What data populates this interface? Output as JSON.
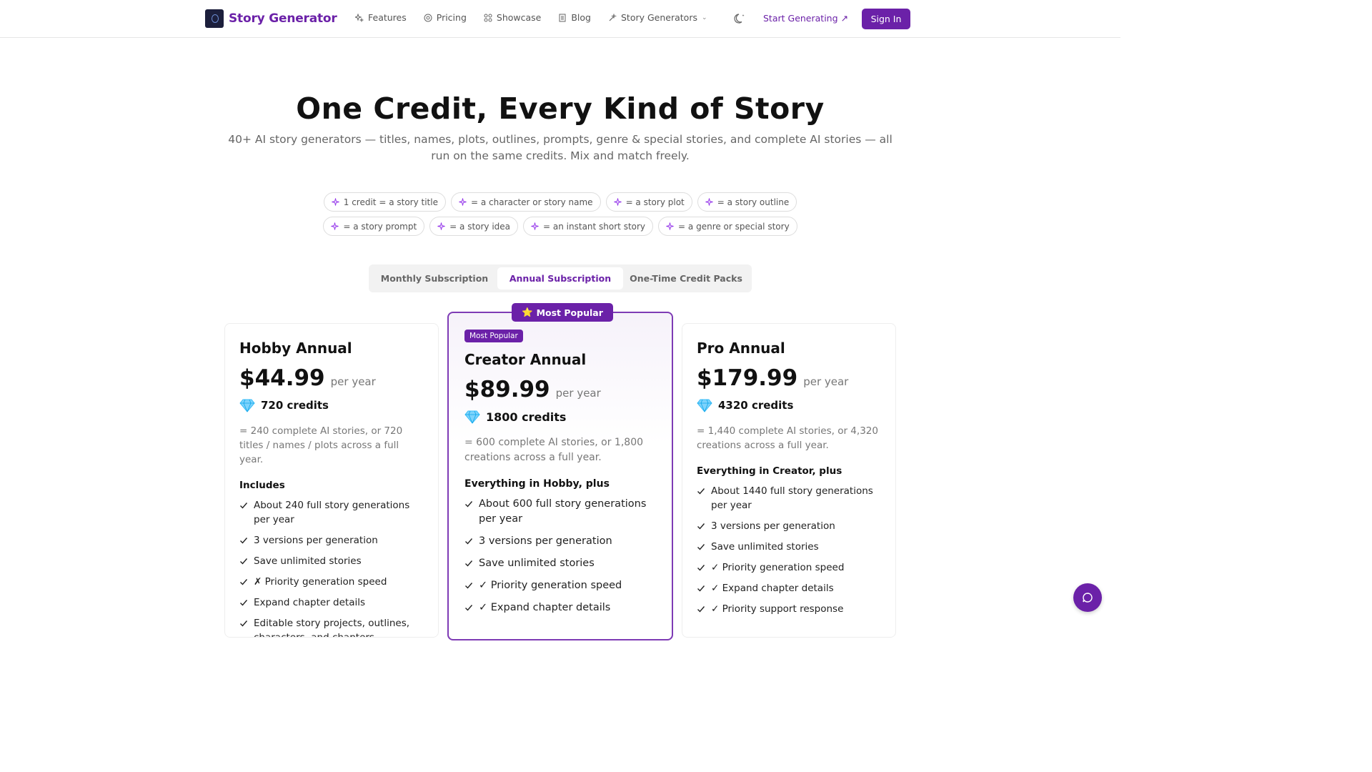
{
  "header": {
    "brand": "Story Generator",
    "nav": [
      {
        "label": "Features",
        "icon": "sparkles-icon"
      },
      {
        "label": "Pricing",
        "icon": "coin-icon"
      },
      {
        "label": "Showcase",
        "icon": "grid-icon"
      },
      {
        "label": "Blog",
        "icon": "document-icon"
      },
      {
        "label": "Story Generators",
        "icon": "magic-wand-icon"
      }
    ],
    "start_label": "Start Generating",
    "signin_label": "Sign In"
  },
  "hero": {
    "title": "One Credit, Every Kind of Story",
    "subtitle": "40+ AI story generators — titles, names, plots, outlines, prompts, genre & special stories, and complete AI stories — all run on the same credits. Mix and match freely."
  },
  "chips": {
    "row1": [
      "1 credit = a story title",
      "= a character or story name",
      "= a story plot",
      "= a story outline"
    ],
    "row2": [
      "= a story prompt",
      "= a story idea",
      "= an instant short story",
      "= a genre or special story"
    ]
  },
  "tabs": [
    {
      "label": "Monthly Subscription",
      "active": false
    },
    {
      "label": "Annual Subscription",
      "active": true
    },
    {
      "label": "One-Time Credit Packs",
      "active": false
    }
  ],
  "plans": {
    "hobby": {
      "name": "Hobby Annual",
      "price": "$44.99",
      "per": "per year",
      "credits": "720 credits",
      "desc": "= 240 complete AI stories, or 720 titles / names / plots across a full year.",
      "features_head": "Includes",
      "features": [
        "About 240 full story generations per year",
        "3 versions per generation",
        "Save unlimited stories",
        "✗ Priority generation speed",
        "Expand chapter details",
        "Editable story projects, outlines, characters, and chapters"
      ]
    },
    "creator": {
      "ribbon": "Most Popular",
      "ribbon_star": "⭐",
      "badge": "Most Popular",
      "name": "Creator Annual",
      "price": "$89.99",
      "per": "per year",
      "credits": "1800 credits",
      "desc": "= 600 complete AI stories, or 1,800 creations across a full year.",
      "features_head": "Everything in Hobby, plus",
      "features": [
        "About 600 full story generations per year",
        "3 versions per generation",
        "Save unlimited stories",
        "✓ Priority generation speed",
        "✓ Expand chapter details"
      ]
    },
    "pro": {
      "name": "Pro Annual",
      "price": "$179.99",
      "per": "per year",
      "credits": "4320 credits",
      "desc": "= 1,440 complete AI stories, or 4,320 creations across a full year.",
      "features_head": "Everything in Creator, plus",
      "features": [
        "About 1440 full story generations per year",
        "3 versions per generation",
        "Save unlimited stories",
        "✓ Priority generation speed",
        "✓ Expand chapter details",
        "✓ Priority support response"
      ]
    }
  },
  "colors": {
    "accent": "#6b21a8",
    "text": "#111111",
    "muted": "#777777"
  }
}
